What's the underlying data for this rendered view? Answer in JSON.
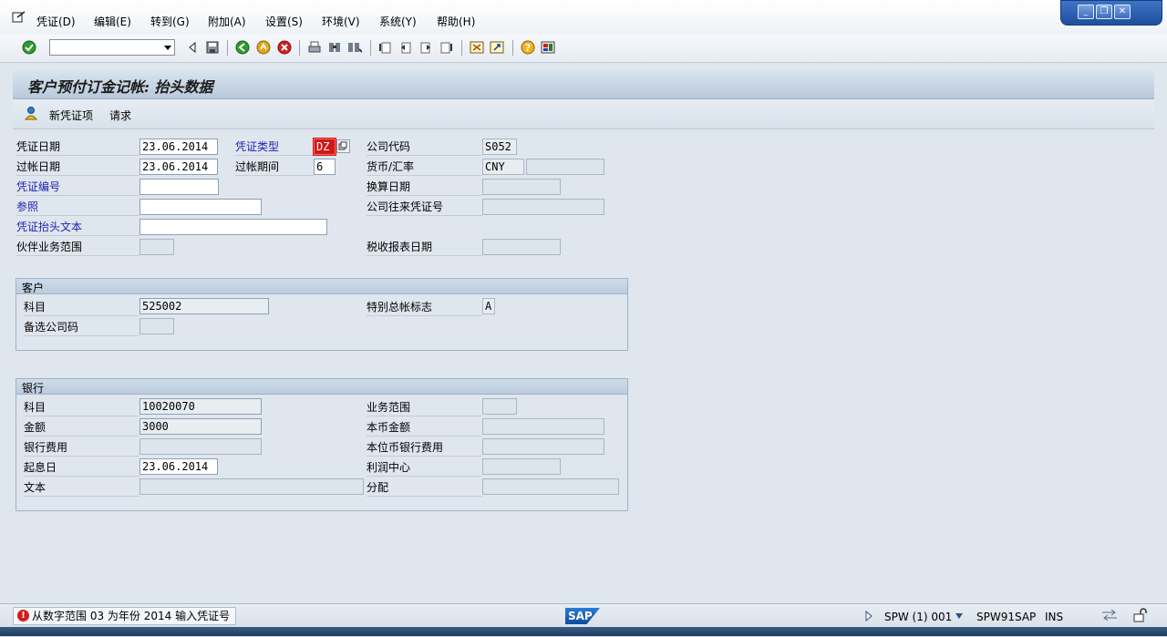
{
  "menu": {
    "items": [
      "凭证(D)",
      "编辑(E)",
      "转到(G)",
      "附加(A)",
      "设置(S)",
      "环境(V)",
      "系统(Y)",
      "帮助(H)"
    ]
  },
  "window_controls": [
    "minimize",
    "restore",
    "close"
  ],
  "toolbar": {
    "command_field": "",
    "icons": [
      "enter-icon",
      "back-nav-icon",
      "save-icon",
      "back-icon",
      "exit-icon",
      "cancel-icon",
      "print-icon",
      "find-icon",
      "find-next-icon",
      "first-page-icon",
      "prev-page-icon",
      "next-page-icon",
      "last-page-icon",
      "new-session-icon",
      "shortcut-icon",
      "help-icon",
      "layout-icon"
    ]
  },
  "title": "客户预付订金记帐: 抬头数据",
  "appbar": {
    "new_item": "新凭证项",
    "request": "请求"
  },
  "header": {
    "doc_date_label": "凭证日期",
    "doc_date": "23.06.2014",
    "doc_type_label": "凭证类型",
    "doc_type": "DZ",
    "company_code_label": "公司代码",
    "company_code": "S052",
    "posting_date_label": "过帐日期",
    "posting_date": "23.06.2014",
    "period_label": "过帐期间",
    "period": "6",
    "currency_label": "货币/汇率",
    "currency": "CNY",
    "rate": "",
    "doc_number_label": "凭证编号",
    "doc_number": "",
    "translation_date_label": "换算日期",
    "translation_date": "",
    "reference_label": "参照",
    "reference": "",
    "intercompany_label": "公司往来凭证号",
    "intercompany": "",
    "header_text_label": "凭证抬头文本",
    "header_text": "",
    "partner_ba_label": "伙伴业务范围",
    "partner_ba": "",
    "tax_report_date_label": "税收报表日期",
    "tax_report_date": ""
  },
  "customer": {
    "title": "客户",
    "account_label": "科目",
    "account": "525002",
    "sgl_label": "特别总帐标志",
    "sgl": "A",
    "alt_cc_label": "备选公司码",
    "alt_cc": ""
  },
  "bank": {
    "title": "银行",
    "account_label": "科目",
    "account": "10020070",
    "business_area_label": "业务范围",
    "business_area": "",
    "amount_label": "金额",
    "amount": "3000",
    "local_amount_label": "本币金额",
    "local_amount": "",
    "bank_charges_label": "银行费用",
    "bank_charges": "",
    "local_bank_charges_label": "本位币银行费用",
    "local_bank_charges": "",
    "value_date_label": "起息日",
    "value_date": "23.06.2014",
    "profit_center_label": "利润中心",
    "profit_center": "",
    "text_label": "文本",
    "text": "",
    "assignment_label": "分配",
    "assignment": ""
  },
  "status": {
    "message": "从数字范围 03 为年份 2014 输入凭证号",
    "sap_logo": "SAP",
    "session": "SPW (1) 001",
    "server": "SPW91SAP",
    "mode": "INS"
  },
  "colors": {
    "accent": "#1f1fb0",
    "error": "#d21d1d",
    "background": "#dfe6ee"
  }
}
